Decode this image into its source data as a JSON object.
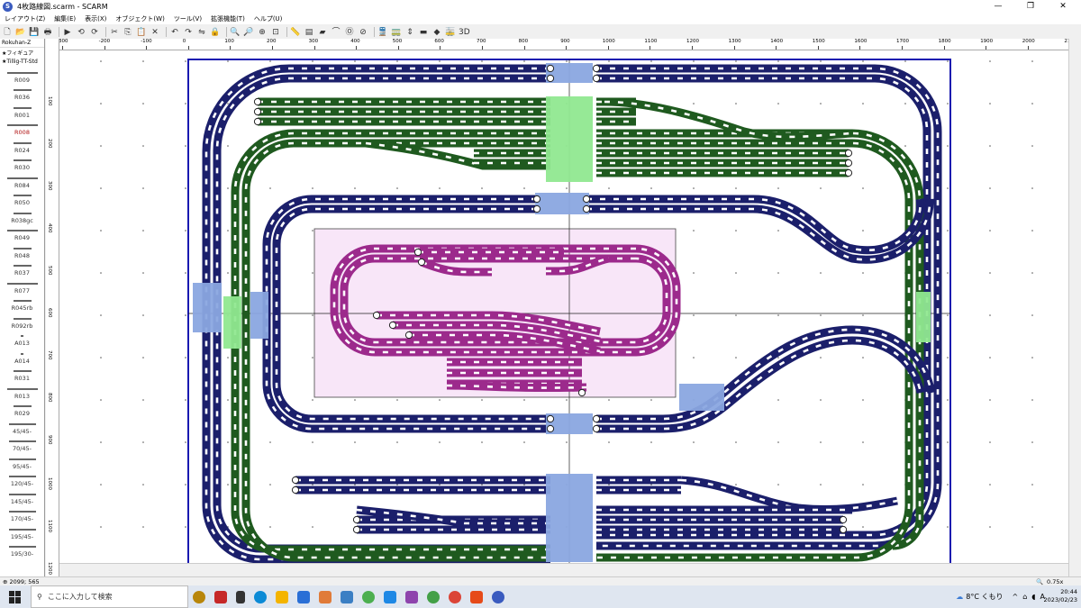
{
  "window": {
    "title": "4枚路線図.scarm - SCARM",
    "app_icon": "S",
    "controls": [
      "—",
      "❐",
      "✕"
    ]
  },
  "menu": [
    "レイアウト(Z)",
    "編集(E)",
    "表示(X)",
    "オブジェクト(W)",
    "ツール(V)",
    "拡張機能(T)",
    "ヘルプ(U)"
  ],
  "toolbar": {
    "icons": [
      "new-icon",
      "open-icon",
      "save-icon",
      "print-icon",
      "run-icon",
      "undo-icon",
      "redo-icon",
      "cut-icon",
      "copy-icon",
      "paste-icon",
      "delete-icon",
      "rotate-left-icon",
      "rotate-right-icon",
      "flip-icon",
      "lock-icon",
      "zoom-in-icon",
      "zoom-out-icon",
      "zoom-area-icon",
      "zoom-fit-icon",
      "ruler-icon",
      "layer-icon",
      "terrain-icon",
      "bridge-icon",
      "tunnel-icon",
      "signal-icon",
      "train-icon",
      "car-icon",
      "height-icon",
      "color-icon",
      "object-icon",
      "wagon-icon",
      "3d-icon"
    ],
    "glyphs": [
      "🗋",
      "📂",
      "💾",
      "🖶",
      "▶",
      "⟲",
      "⟳",
      "✂",
      "⎘",
      "📋",
      "✕",
      "↶",
      "↷",
      "⇋",
      "🔒",
      "🔍",
      "🔎",
      "⊕",
      "⊡",
      "📏",
      "▤",
      "▰",
      "⌒",
      "Ⓞ",
      "⊘",
      "🚆",
      "🚃",
      "⇕",
      "▬",
      "◆",
      "🚋",
      "3D"
    ]
  },
  "library": {
    "name": "Rokuhan-Z",
    "favorites": [
      "★フィギュア",
      "★Tillig-TT-Std"
    ],
    "items": [
      "R009",
      "R036",
      "R001",
      "R008",
      "R024",
      "R030",
      "R084",
      "R050",
      "R038gc",
      "R049",
      "R048",
      "R037",
      "R077",
      "R045rb",
      "R092rb",
      "A013",
      "A014",
      "R031",
      "R013",
      "R029",
      "45/45-",
      "70/45-",
      "95/45-",
      "120/45-",
      "145/45-",
      "170/45-",
      "195/45-",
      "195/30-"
    ],
    "selected": "R008"
  },
  "rulers": {
    "h": [
      "-300",
      "-200",
      "-100",
      "0",
      "100",
      "200",
      "300",
      "400",
      "500",
      "600",
      "700",
      "800",
      "900",
      "1000",
      "1100",
      "1200",
      "1300",
      "1400",
      "1500",
      "1600",
      "1700",
      "1800",
      "1900",
      "2000",
      "2100"
    ],
    "h_unit": "mm",
    "v": [
      "100",
      "200",
      "300",
      "400",
      "500",
      "600",
      "700",
      "800",
      "900",
      "1000",
      "1100",
      "1200"
    ]
  },
  "status": {
    "coords": "2099; 565",
    "zoom": "0.75x"
  },
  "taskbar": {
    "search_placeholder": "ここに入力して検索",
    "weather": "8°C くもり",
    "ime": "A",
    "time": "20:44",
    "date": "2023/02/23",
    "notif": "27"
  },
  "colors": {
    "blue_track": "#1b1f6b",
    "green_track": "#1f5a1f",
    "magenta_track": "#9c2a8c",
    "bridge_blue": "#8aa6e0",
    "bridge_green": "#90e890",
    "board_border": "#1a1ab0",
    "inner_board": "#f8e6f8"
  }
}
